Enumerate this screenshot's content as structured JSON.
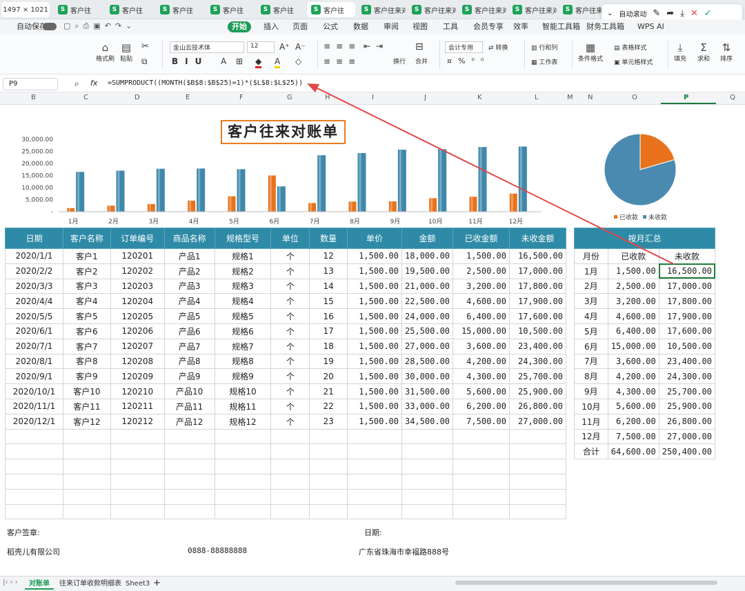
{
  "window": {
    "size_label": "1497 × 1021",
    "tabs": [
      "客户往",
      "客户往",
      "客户往",
      "客户往",
      "客户往",
      "客户往",
      "客户往来对",
      "客户往来对",
      "客户往来对",
      "客户往来对",
      "客户往来"
    ],
    "active_tab": 5
  },
  "floatbar": {
    "autoscroll_label": "自动滚动"
  },
  "menu": {
    "autosave": "自动保存",
    "items": [
      "开始",
      "插入",
      "页面",
      "公式",
      "数据",
      "审阅",
      "视图",
      "工具",
      "会员专享",
      "效率",
      "智能工具箱",
      "财务工具箱",
      "WPS AI"
    ],
    "active": "开始"
  },
  "ribbon": {
    "format_painter": "格式刷",
    "paste": "粘贴",
    "font_name": "金山云技术体",
    "font_size": "12",
    "number_format": "会计专用",
    "convert": "转换",
    "rows_cols": "行和列",
    "worksheet": "工作表",
    "table_style": "表格样式",
    "cond_format": "条件格式",
    "cell_style": "单元格样式",
    "wrap": "换行",
    "merge": "合并",
    "fill": "填充",
    "sum": "求和",
    "sort": "排序"
  },
  "formula_bar": {
    "cell_ref": "P9",
    "fx": "fx",
    "formula": "=SUMPRODUCT((MONTH($B$8:$B$25)=1)*($L$8:$L$25))"
  },
  "columns": [
    "B",
    "C",
    "D",
    "E",
    "F",
    "G",
    "H",
    "I",
    "J",
    "K",
    "L",
    "M",
    "N",
    "O",
    "P",
    "Q"
  ],
  "title": "客户往来对账单",
  "chart_data": [
    {
      "type": "bar",
      "categories": [
        "1月",
        "2月",
        "3月",
        "4月",
        "5月",
        "6月",
        "7月",
        "8月",
        "9月",
        "10月",
        "11月",
        "12月"
      ],
      "series": [
        {
          "values": [
            1500,
            2500,
            3200,
            4600,
            6400,
            15000,
            3600,
            4200,
            4300,
            5600,
            6200,
            7500
          ],
          "color": "#e8731c"
        },
        {
          "values": [
            16500,
            17000,
            17800,
            17900,
            17600,
            10500,
            23400,
            24300,
            25700,
            25900,
            26800,
            27000
          ],
          "color": "#3f88ab"
        }
      ],
      "yticks": [
        "30,000.00",
        "25,000.00",
        "20,000.00",
        "15,000.00",
        "10,000.00",
        "5,000.00",
        "-"
      ],
      "ylim": [
        0,
        30000
      ]
    },
    {
      "type": "pie",
      "series": [
        {
          "name": "已收款",
          "value": 64600,
          "color": "#e8731c"
        },
        {
          "name": "未收款",
          "value": 250400,
          "color": "#4a8ab0"
        }
      ],
      "legend": "bottom"
    }
  ],
  "table": {
    "headers": [
      "日期",
      "客户名称",
      "订单编号",
      "商品名称",
      "规格型号",
      "单位",
      "数量",
      "单价",
      "金额",
      "已收金额",
      "未收金额"
    ],
    "rows": [
      [
        "2020/1/1",
        "客户1",
        "120201",
        "产品1",
        "规格1",
        "个",
        "12",
        "1,500.00",
        "18,000.00",
        "1,500.00",
        "16,500.00"
      ],
      [
        "2020/2/2",
        "客户2",
        "120202",
        "产品2",
        "规格2",
        "个",
        "13",
        "1,500.00",
        "19,500.00",
        "2,500.00",
        "17,000.00"
      ],
      [
        "2020/3/3",
        "客户3",
        "120203",
        "产品3",
        "规格3",
        "个",
        "14",
        "1,500.00",
        "21,000.00",
        "3,200.00",
        "17,800.00"
      ],
      [
        "2020/4/4",
        "客户4",
        "120204",
        "产品4",
        "规格4",
        "个",
        "15",
        "1,500.00",
        "22,500.00",
        "4,600.00",
        "17,900.00"
      ],
      [
        "2020/5/5",
        "客户5",
        "120205",
        "产品5",
        "规格5",
        "个",
        "16",
        "1,500.00",
        "24,000.00",
        "6,400.00",
        "17,600.00"
      ],
      [
        "2020/6/1",
        "客户6",
        "120206",
        "产品6",
        "规格6",
        "个",
        "17",
        "1,500.00",
        "25,500.00",
        "15,000.00",
        "10,500.00"
      ],
      [
        "2020/7/1",
        "客户7",
        "120207",
        "产品7",
        "规格7",
        "个",
        "18",
        "1,500.00",
        "27,000.00",
        "3,600.00",
        "23,400.00"
      ],
      [
        "2020/8/1",
        "客户8",
        "120208",
        "产品8",
        "规格8",
        "个",
        "19",
        "1,500.00",
        "28,500.00",
        "4,200.00",
        "24,300.00"
      ],
      [
        "2020/9/1",
        "客户9",
        "120209",
        "产品9",
        "规格9",
        "个",
        "20",
        "1,500.00",
        "30,000.00",
        "4,300.00",
        "25,700.00"
      ],
      [
        "2020/10/1",
        "客户10",
        "120210",
        "产品10",
        "规格10",
        "个",
        "21",
        "1,500.00",
        "31,500.00",
        "5,600.00",
        "25,900.00"
      ],
      [
        "2020/11/1",
        "客户11",
        "120211",
        "产品11",
        "规格11",
        "个",
        "22",
        "1,500.00",
        "33,000.00",
        "6,200.00",
        "26,800.00"
      ],
      [
        "2020/12/1",
        "客户12",
        "120212",
        "产品12",
        "规格12",
        "个",
        "23",
        "1,500.00",
        "34,500.00",
        "7,500.00",
        "27,000.00"
      ]
    ]
  },
  "summary": {
    "title": "按月汇总",
    "headers": [
      "月份",
      "已收款",
      "未收款"
    ],
    "rows": [
      [
        "1月",
        "1,500.00",
        "16,500.00"
      ],
      [
        "2月",
        "2,500.00",
        "17,000.00"
      ],
      [
        "3月",
        "3,200.00",
        "17,800.00"
      ],
      [
        "4月",
        "4,600.00",
        "17,900.00"
      ],
      [
        "5月",
        "6,400.00",
        "17,600.00"
      ],
      [
        "6月",
        "15,000.00",
        "10,500.00"
      ],
      [
        "7月",
        "3,600.00",
        "23,400.00"
      ],
      [
        "8月",
        "4,200.00",
        "24,300.00"
      ],
      [
        "9月",
        "4,300.00",
        "25,700.00"
      ],
      [
        "10月",
        "5,600.00",
        "25,900.00"
      ],
      [
        "11月",
        "6,200.00",
        "26,800.00"
      ],
      [
        "12月",
        "7,500.00",
        "27,000.00"
      ],
      [
        "合计",
        "64,600.00",
        "250,400.00"
      ]
    ]
  },
  "footer": {
    "sign": "客户签章:",
    "date": "日期:",
    "company": "稻壳儿有限公司",
    "phone": "0888-88888888",
    "address": "广东省珠海市幸福路888号"
  },
  "sheets": [
    "对账单",
    "往来订单收款明细表",
    "Sheet3"
  ],
  "active_sheet": "对账单"
}
